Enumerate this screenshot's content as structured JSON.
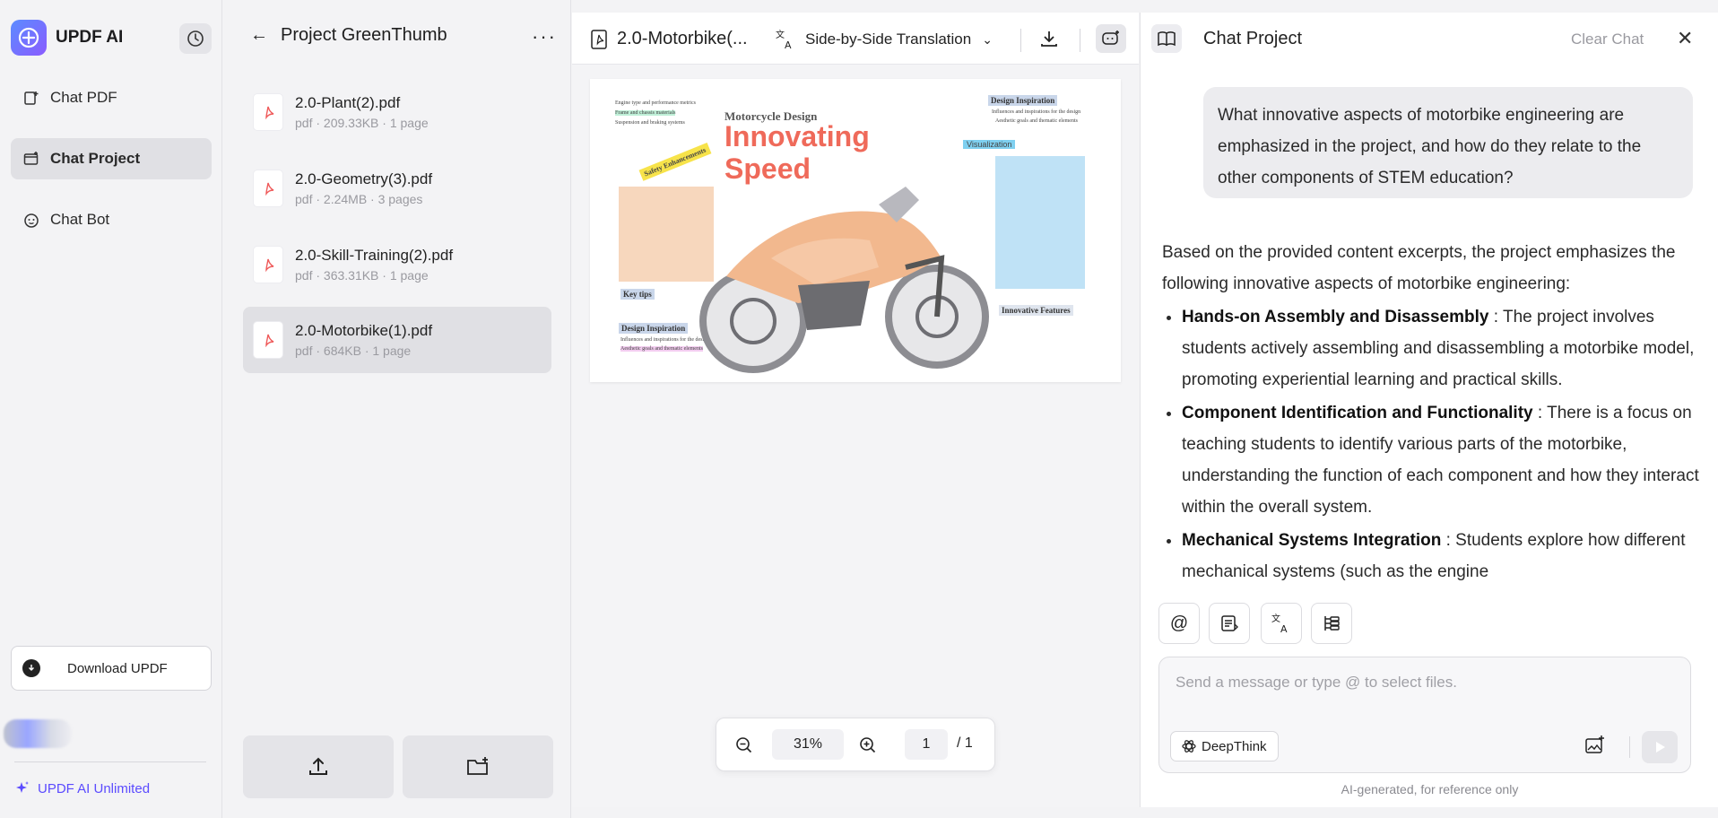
{
  "sidebar": {
    "app_title": "UPDF AI",
    "nav": [
      {
        "label": "Chat PDF",
        "icon": "chat-pdf-icon"
      },
      {
        "label": "Chat Project",
        "icon": "chat-project-icon",
        "active": true
      },
      {
        "label": "Chat Bot",
        "icon": "chat-bot-icon"
      }
    ],
    "download_label": "Download UPDF",
    "unlimited_label": "UPDF AI Unlimited"
  },
  "files": {
    "project_title": "Project GreenThumb",
    "items": [
      {
        "name": "2.0-Plant(2).pdf",
        "meta": "pdf · 209.33KB · 1 page"
      },
      {
        "name": "2.0-Geometry(3).pdf",
        "meta": "pdf · 2.24MB · 3 pages"
      },
      {
        "name": "2.0-Skill-Training(2).pdf",
        "meta": "pdf · 363.31KB · 1 page"
      },
      {
        "name": "2.0-Motorbike(1).pdf",
        "meta": "pdf · 684KB · 1 page",
        "active": true
      }
    ]
  },
  "viewer": {
    "doc_title": "2.0-Motorbike(...",
    "translate_label": "Side-by-Side Translation",
    "zoom": "31%",
    "page_current": "1",
    "page_total": "/ 1",
    "page_content": {
      "small_top": [
        "Engine type and performance metrics",
        "Frame and chassis materials",
        "Suspension and braking systems"
      ],
      "moto_design": "Motorcycle Design",
      "headline_1": "Innovating",
      "headline_2": "Speed",
      "design_inspiration": "Design Inspiration",
      "design_points": [
        "Influences and inspirations for the design",
        "Aesthetic goals and thematic elements"
      ],
      "safety": "Safety Enhancements",
      "visualization": "Visualization",
      "innovative_features": "Innovative Features",
      "key_tips": "Key tips"
    }
  },
  "chat": {
    "title": "Chat Project",
    "clear_label": "Clear Chat",
    "user_message": "What innovative aspects of motorbike engineering are emphasized in the project, and how do they relate to the other components of STEM education?",
    "answer_intro": "Based on the provided content excerpts, the project emphasizes the following innovative aspects of motorbike engineering:",
    "answer_points": [
      {
        "title": "Hands-on Assembly and Disassembly",
        "text": " : The project involves students actively assembling and disassembling a motorbike model, promoting experiential learning and practical skills."
      },
      {
        "title": "Component Identification and Functionality",
        "text": " : There is a focus on teaching students to identify various parts of the motorbike, understanding the function of each component and how they interact within the overall system."
      },
      {
        "title": "Mechanical Systems Integration",
        "text": " : Students explore how different mechanical systems (such as the engine"
      }
    ],
    "input_placeholder": "Send a message or type @ to select files.",
    "deepthink_label": "DeepThink",
    "disclaimer": "AI-generated, for reference only"
  }
}
